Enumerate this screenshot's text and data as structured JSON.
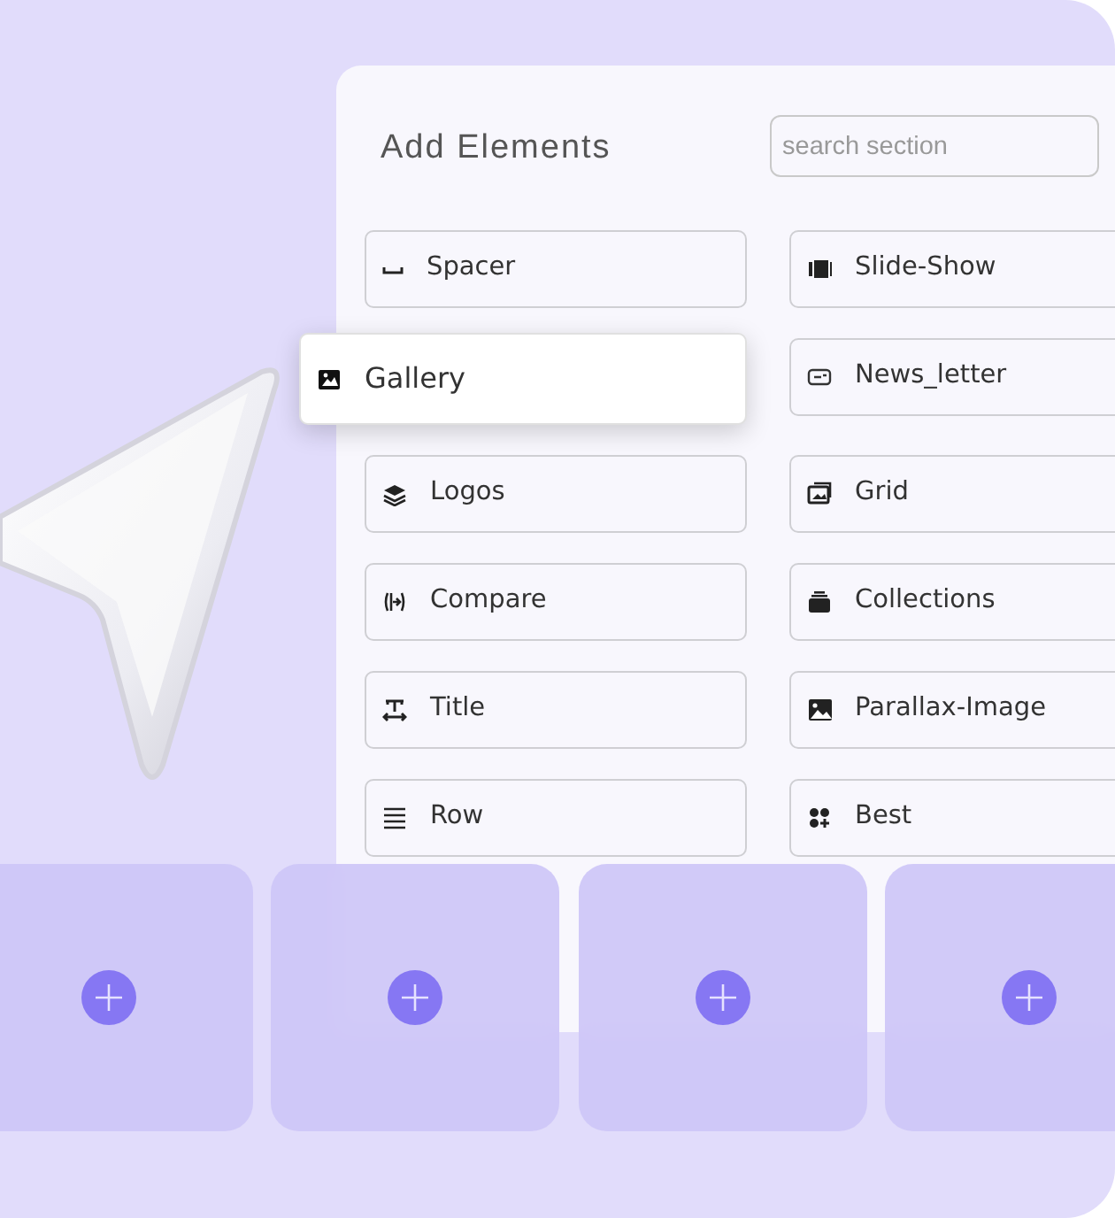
{
  "panel": {
    "title": "Add Elements",
    "search": {
      "placeholder": "search section"
    },
    "items": [
      {
        "label": "Spacer",
        "dragging": false
      },
      {
        "label": "Slide-Show",
        "dragging": false
      },
      {
        "label": "Gallery",
        "dragging": true
      },
      {
        "label": "News_letter",
        "dragging": false
      },
      {
        "label": "Logos",
        "dragging": false
      },
      {
        "label": "Grid",
        "dragging": false
      },
      {
        "label": "Compare",
        "dragging": false
      },
      {
        "label": "Collections",
        "dragging": false
      },
      {
        "label": "Title",
        "dragging": false
      },
      {
        "label": "Parallax-Image",
        "dragging": false
      },
      {
        "label": "Row",
        "dragging": false
      },
      {
        "label": "Best",
        "dragging": false
      }
    ]
  },
  "drop_slots": [
    {
      "kind": "empty"
    },
    {
      "kind": "empty"
    },
    {
      "kind": "empty"
    },
    {
      "kind": "empty"
    }
  ]
}
